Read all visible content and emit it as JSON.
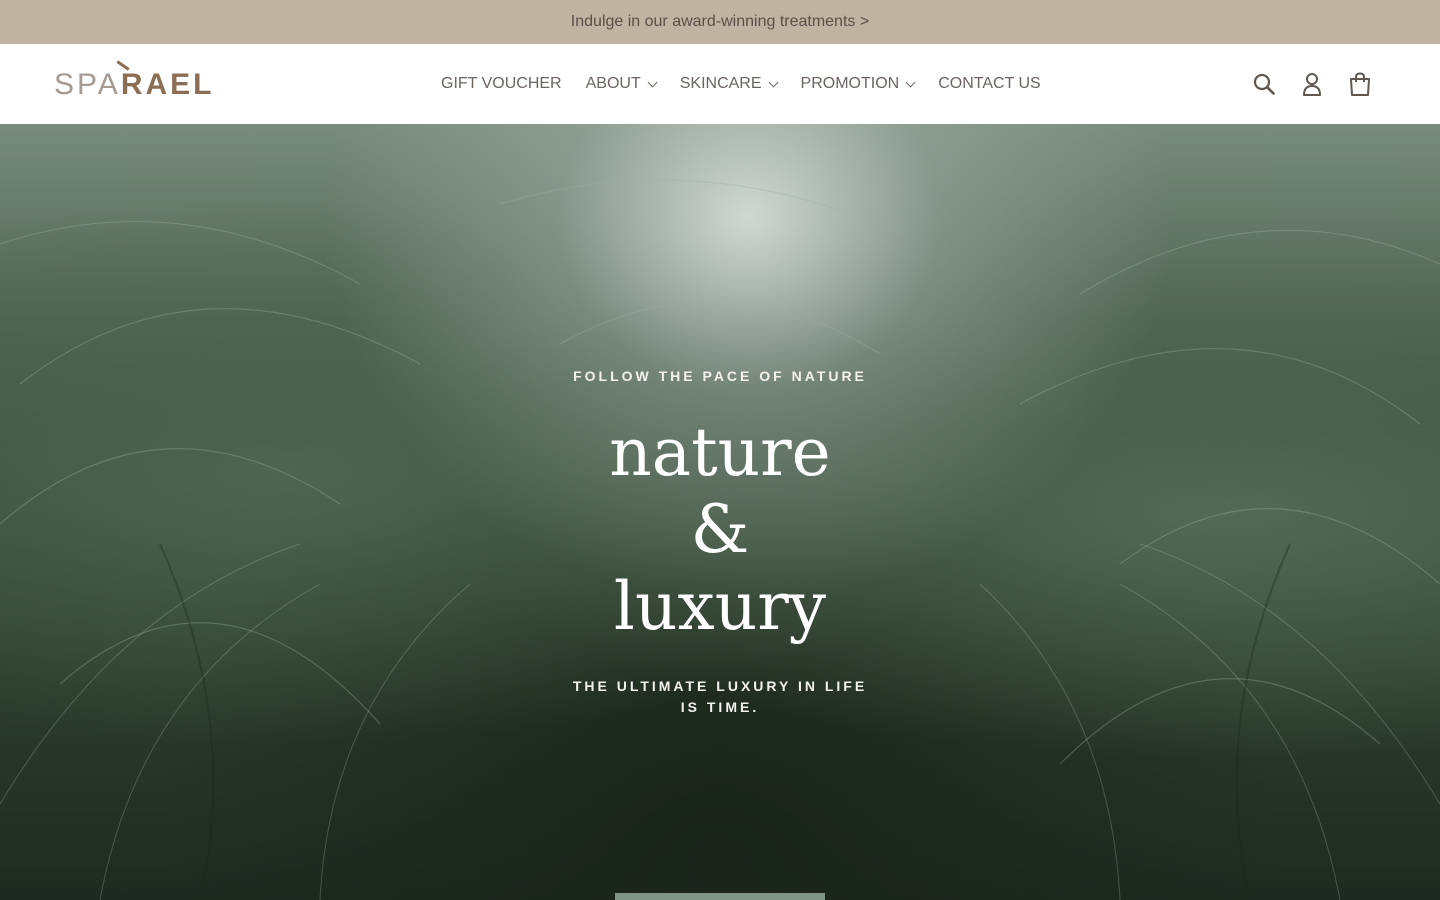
{
  "announcement": {
    "text": "Indulge in our award-winning treatments >"
  },
  "header": {
    "logo": {
      "part1": "SPA",
      "part2": "RAEL"
    },
    "nav": [
      {
        "label": "GIFT VOUCHER",
        "dropdown": false
      },
      {
        "label": "ABOUT",
        "dropdown": true
      },
      {
        "label": "SKINCARE",
        "dropdown": true
      },
      {
        "label": "PROMOTION",
        "dropdown": true
      },
      {
        "label": "CONTACT US",
        "dropdown": false
      }
    ],
    "icons": [
      "search-icon",
      "account-icon",
      "cart-icon"
    ]
  },
  "hero": {
    "eyebrow": "FOLLOW THE PACE OF NATURE",
    "headline_line1": "nature",
    "headline_line2": "&",
    "headline_line3": "luxury",
    "subheading_line1": "THE ULTIMATE LUXURY IN LIFE",
    "subheading_line2": "IS TIME."
  },
  "colors": {
    "announcement_bg": "#c1b3a2",
    "logo_light": "#a59b93",
    "logo_dark": "#8a6f55",
    "nav_text": "#6b6460",
    "cta_bg": "#7e9586"
  }
}
